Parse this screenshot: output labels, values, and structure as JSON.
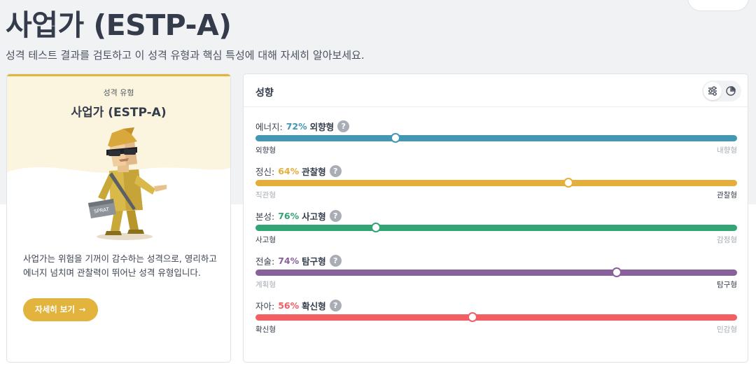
{
  "page": {
    "title": "사업가 (ESTP-A)",
    "subtitle": "성격 테스트 결과를 검토하고 이 성격 유형과 핵심 특성에 대해 자세히 알아보세요."
  },
  "type_card": {
    "label": "성격 유형",
    "name": "사업가 (ESTP-A)",
    "avatar_badge": "SPRAT",
    "description": "사업가는 위험을 기꺼이 감수하는 성격으로, 영리하고 에너지 넘치며 관찰력이 뛰어난 성격 유형입니다.",
    "button_label": "자세히 보기",
    "button_arrow": "→",
    "accent": "#e2b33d"
  },
  "traits_card": {
    "title": "성향",
    "view_icons": [
      "sliders-icon",
      "pie-chart-icon"
    ],
    "traits": [
      {
        "label": "에너지:",
        "percent": "72%",
        "winner": "외향형",
        "left": "외향형",
        "right": "내향형",
        "knob_position": 0.29,
        "winning_side": "left",
        "color": "#4298b4"
      },
      {
        "label": "정신:",
        "percent": "64%",
        "winner": "관찰형",
        "left": "직관형",
        "right": "관찰형",
        "knob_position": 0.65,
        "winning_side": "right",
        "color": "#e4ae3a"
      },
      {
        "label": "본성:",
        "percent": "76%",
        "winner": "사고형",
        "left": "사고형",
        "right": "감정형",
        "knob_position": 0.25,
        "winning_side": "left",
        "color": "#33a474"
      },
      {
        "label": "전술:",
        "percent": "74%",
        "winner": "탐구형",
        "left": "계획형",
        "right": "탐구형",
        "knob_position": 0.75,
        "winning_side": "right",
        "color": "#88619a"
      },
      {
        "label": "자아:",
        "percent": "56%",
        "winner": "확신형",
        "left": "확신형",
        "right": "민감형",
        "knob_position": 0.45,
        "winning_side": "left",
        "color": "#f25e62"
      }
    ]
  }
}
